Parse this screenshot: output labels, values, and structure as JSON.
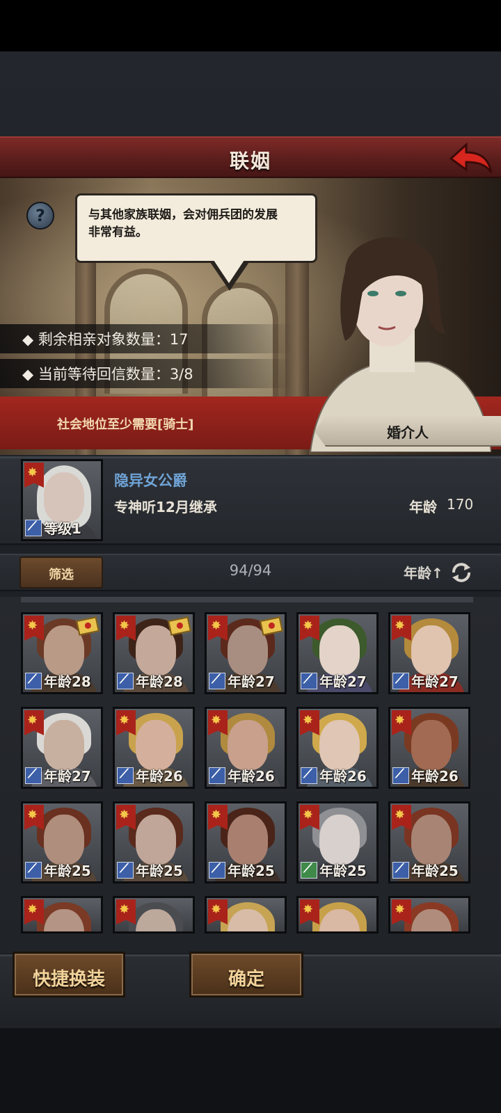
{
  "header": {
    "title": "联姻"
  },
  "dialog": {
    "text_line1": "与其他家族联姻，会对佣兵团的发展",
    "text_line2": "非常有益。"
  },
  "stats": {
    "remaining": "◆ 剩余相亲对象数量：17",
    "pending": "◆ 当前等待回信数量：3/8"
  },
  "status": {
    "requirement": "社会地位至少需要[骑士]",
    "matchmaker_label": "婚介人"
  },
  "heir": {
    "name": "隐异女公爵",
    "trait": "专神听12月继承",
    "age_label": "年龄",
    "age": "170",
    "level": "等级1"
  },
  "filter": {
    "label": "筛选",
    "count": "94/94",
    "sort": "年龄↑"
  },
  "candidates": [
    {
      "age": "年龄28",
      "letter": true,
      "hair": "#6b3a26",
      "skin": "#b99a86",
      "cloth": "#4a3a2d",
      "tag": "blue"
    },
    {
      "age": "年龄28",
      "letter": true,
      "hair": "#3e2418",
      "skin": "#c4a99a",
      "cloth": "#5b4a3c",
      "tag": "blue"
    },
    {
      "age": "年龄27",
      "letter": true,
      "hair": "#5c2a1c",
      "skin": "#a88e80",
      "cloth": "#4b3b2e",
      "tag": "blue"
    },
    {
      "age": "年龄27",
      "letter": false,
      "hair": "#3c5a2c",
      "skin": "#e3d3c8",
      "cloth": "#4b4a6a",
      "tag": "blue"
    },
    {
      "age": "年龄27",
      "letter": false,
      "hair": "#b48a3c",
      "skin": "#e0c4b0",
      "cloth": "#8a2c24",
      "tag": "blue"
    },
    {
      "age": "年龄27",
      "letter": false,
      "hair": "#d9d8d4",
      "skin": "#c8b0a0",
      "cloth": "#5d5f64",
      "tag": "blue"
    },
    {
      "age": "年龄26",
      "letter": false,
      "hair": "#c9a24e",
      "skin": "#d4b09c",
      "cloth": "#6a5a46",
      "tag": "blue"
    },
    {
      "age": "年龄26",
      "letter": false,
      "hair": "#b08a3e",
      "skin": "#c8a08c",
      "cloth": "#4a4a4f",
      "tag": "blue"
    },
    {
      "age": "年龄26",
      "letter": false,
      "hair": "#cfa94c",
      "skin": "#e0c6b4",
      "cloth": "#56606a",
      "tag": "blue"
    },
    {
      "age": "年龄26",
      "letter": false,
      "hair": "#7a3a22",
      "skin": "#a26a52",
      "cloth": "#4a3a2d",
      "tag": "blue"
    },
    {
      "age": "年龄25",
      "letter": false,
      "hair": "#6a3020",
      "skin": "#b08e7e",
      "cloth": "#564536",
      "tag": "blue"
    },
    {
      "age": "年龄25",
      "letter": false,
      "hair": "#5a2a1c",
      "skin": "#c0a698",
      "cloth": "#5a4a3c",
      "tag": "blue"
    },
    {
      "age": "年龄25",
      "letter": false,
      "hair": "#4a2418",
      "skin": "#a98070",
      "cloth": "#3e3129",
      "tag": "blue"
    },
    {
      "age": "年龄25",
      "letter": false,
      "hair": "#8e9094",
      "skin": "#d8d0cc",
      "cloth": "#3b3c40",
      "tag": "green"
    },
    {
      "age": "年龄25",
      "letter": false,
      "hair": "#7a3422",
      "skin": "#a88474",
      "cloth": "#4b3a2d",
      "tag": "blue"
    },
    {
      "age": "",
      "letter": false,
      "hair": "#7a3a26",
      "skin": "#b49484",
      "cloth": "#4a3a2d",
      "tag": "none"
    },
    {
      "age": "",
      "letter": false,
      "hair": "#4a4c50",
      "skin": "#bda89c",
      "cloth": "#3e3a36",
      "tag": "none"
    },
    {
      "age": "",
      "letter": false,
      "hair": "#c6a454",
      "skin": "#d8bca8",
      "cloth": "#4a4a46",
      "tag": "none"
    },
    {
      "age": "",
      "letter": false,
      "hair": "#c7a04a",
      "skin": "#d9b8a4",
      "cloth": "#4c4a48",
      "tag": "none"
    },
    {
      "age": "",
      "letter": false,
      "hair": "#8a3a24",
      "skin": "#b08c7c",
      "cloth": "#4b3a2e",
      "tag": "none"
    }
  ],
  "buttons": {
    "quick_equip": "快捷换装",
    "confirm": "确定"
  },
  "colors": {
    "title_red": "#7e2a27",
    "status_red": "#a2271f",
    "heir_name_blue": "#6fa3d6",
    "button_gold": "#f3d39a"
  }
}
